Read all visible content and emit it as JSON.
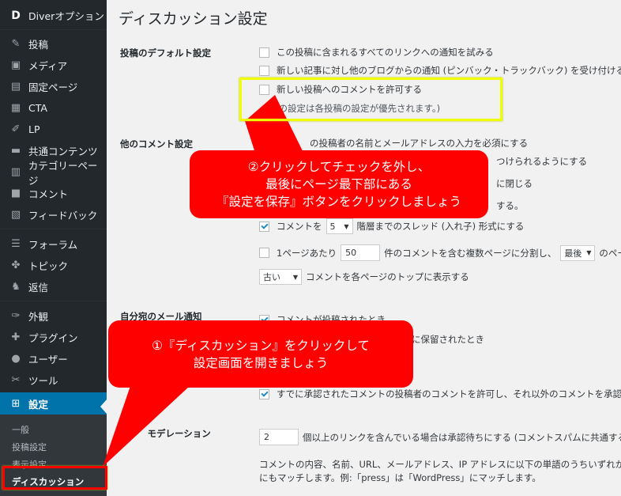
{
  "sidebar": {
    "brand": "Diverオプション",
    "items": [
      {
        "label": "投稿",
        "icon": "pin-icon"
      },
      {
        "label": "メディア",
        "icon": "media-icon"
      },
      {
        "label": "固定ページ",
        "icon": "page-icon"
      },
      {
        "label": "CTA",
        "icon": "cta-icon"
      },
      {
        "label": "LP",
        "icon": "lp-icon"
      },
      {
        "label": "共通コンテンツ",
        "icon": "folder-icon"
      },
      {
        "label": "カテゴリーページ",
        "icon": "category-icon"
      },
      {
        "label": "コメント",
        "icon": "comment-icon"
      },
      {
        "label": "フィードバック",
        "icon": "feedback-icon"
      },
      {
        "label": "フォーラム",
        "icon": "forum-icon"
      },
      {
        "label": "トピック",
        "icon": "topic-icon"
      },
      {
        "label": "返信",
        "icon": "reply-icon"
      },
      {
        "label": "外観",
        "icon": "appearance-icon"
      },
      {
        "label": "プラグイン",
        "icon": "plugin-icon"
      },
      {
        "label": "ユーザー",
        "icon": "user-icon"
      },
      {
        "label": "ツール",
        "icon": "tools-icon"
      },
      {
        "label": "設定",
        "icon": "settings-icon"
      }
    ],
    "submenu": [
      "一般",
      "投稿設定",
      "表示設定",
      "ディスカッション"
    ]
  },
  "main": {
    "title": "ディスカッション設定",
    "default_section": {
      "label": "投稿のデフォルト設定",
      "opt1": "この投稿に含まれるすべてのリンクへの通知を試みる",
      "opt2": "新しい記事に対し他のブログからの通知 (ピンバック・トラックバック) を受け付ける",
      "opt3": "新しい投稿へのコメントを許可する",
      "note": "(これらの設定は各投稿の設定が優先されます。)",
      "note_visible": "らの設定は各投稿の設定が優先されます。)"
    },
    "other_section": {
      "label": "他のコメント設定",
      "opt1_visible": "の投稿者の名前とメールアドレスの入力を必須にする",
      "opt2_visible": "つけられるようにする",
      "opt3_visible": "に閉じる",
      "opt4_visible": "する。",
      "thread_pre": "コメントを",
      "thread_value": "5",
      "thread_post": "階層までのスレッド (入れ子) 形式にする",
      "page_pre": "1ページあたり",
      "page_value": "50",
      "page_mid": "件のコメントを含む複数ページに分割し、",
      "page_select": "最後",
      "page_post": "のページを",
      "order_select": "古い",
      "order_post": "コメントを各ページのトップに表示する"
    },
    "mail_section": {
      "label_visible": "自分宛のメール通知",
      "opt1_visible": "コメントが投稿されたとき",
      "opt2_visible": "に保留されたとき"
    },
    "before_section": {
      "opt_visible": "すでに承認されたコメントの投稿者のコメントを許可し、それ以外のコメントを承認待ち"
    },
    "moderation_section": {
      "label_visible": "コ　　モデレーション",
      "links_value": "2",
      "links_post": "個以上のリンクを含んでいる場合は承認待ちにする (コメントスパムに共通する特",
      "desc_line1": "コメントの内容、名前、URL、メールアドレス、IP アドレスに以下の単語のうちいずれかで",
      "desc_line2": "にもマッチします。例:「press」は「WordPress」にマッチします。"
    }
  },
  "callouts": {
    "step2": [
      "②クリックしてチェックを外し、",
      "最後にページ最下部にある",
      "『設定を保存』ボタンをクリックしましょう"
    ],
    "step1": [
      "①『ディスカッション』をクリックして",
      "設定画面を開きましょう"
    ]
  },
  "colors": {
    "sidebar_bg": "#23282d",
    "active_blue": "#0073aa",
    "callout_red": "#ff0000",
    "highlight_yellow": "#f0ff00"
  }
}
